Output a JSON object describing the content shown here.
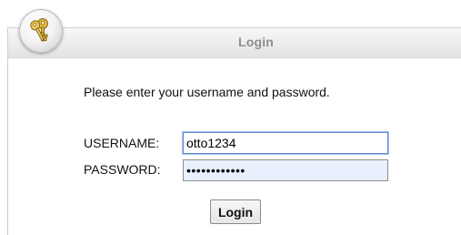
{
  "header": {
    "title": "Login",
    "badge_icon": "keys-icon"
  },
  "form": {
    "prompt": "Please enter your username and password.",
    "username_label": "USERNAME:",
    "username_value": "otto1234",
    "password_label": "PASSWORD:",
    "password_value": "••••••••••••",
    "submit_label": "Login"
  },
  "colors": {
    "focus_border": "#5b8bd0",
    "autofill_background": "#e8f0fe",
    "title_text": "#8e8e8e"
  }
}
